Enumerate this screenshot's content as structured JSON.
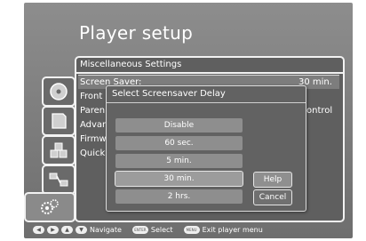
{
  "title": "Player setup",
  "sidebar": {
    "tabs": [
      {
        "name": "disc-icon"
      },
      {
        "name": "card-icon"
      },
      {
        "name": "cubes-icon"
      },
      {
        "name": "network-icon"
      },
      {
        "name": "gears-icon"
      }
    ]
  },
  "panel": {
    "header": "Miscellaneous Settings",
    "items": [
      {
        "label": "Screen Saver:",
        "value": "30 min."
      },
      {
        "label": "Front"
      },
      {
        "label": "Paren",
        "value": "ontrol"
      },
      {
        "label": "Advan"
      },
      {
        "label": "Firmw"
      },
      {
        "label": "Quick"
      }
    ]
  },
  "dialog": {
    "title": "Select Screensaver Delay",
    "options": [
      "Disable",
      "60 sec.",
      "5 min.",
      "30 min.",
      "2 hrs."
    ],
    "selected": "30 min.",
    "buttons": {
      "help": "Help",
      "cancel": "Cancel"
    }
  },
  "footer": {
    "navigate": "Navigate",
    "select_key": "ENTER",
    "select": "Select",
    "exit_key": "MENU",
    "exit": "Exit player menu"
  },
  "colors": {
    "screen_bg": "#7a7a7a",
    "panel_bg": "#5f5f5f",
    "border": "#f2f2f2"
  }
}
